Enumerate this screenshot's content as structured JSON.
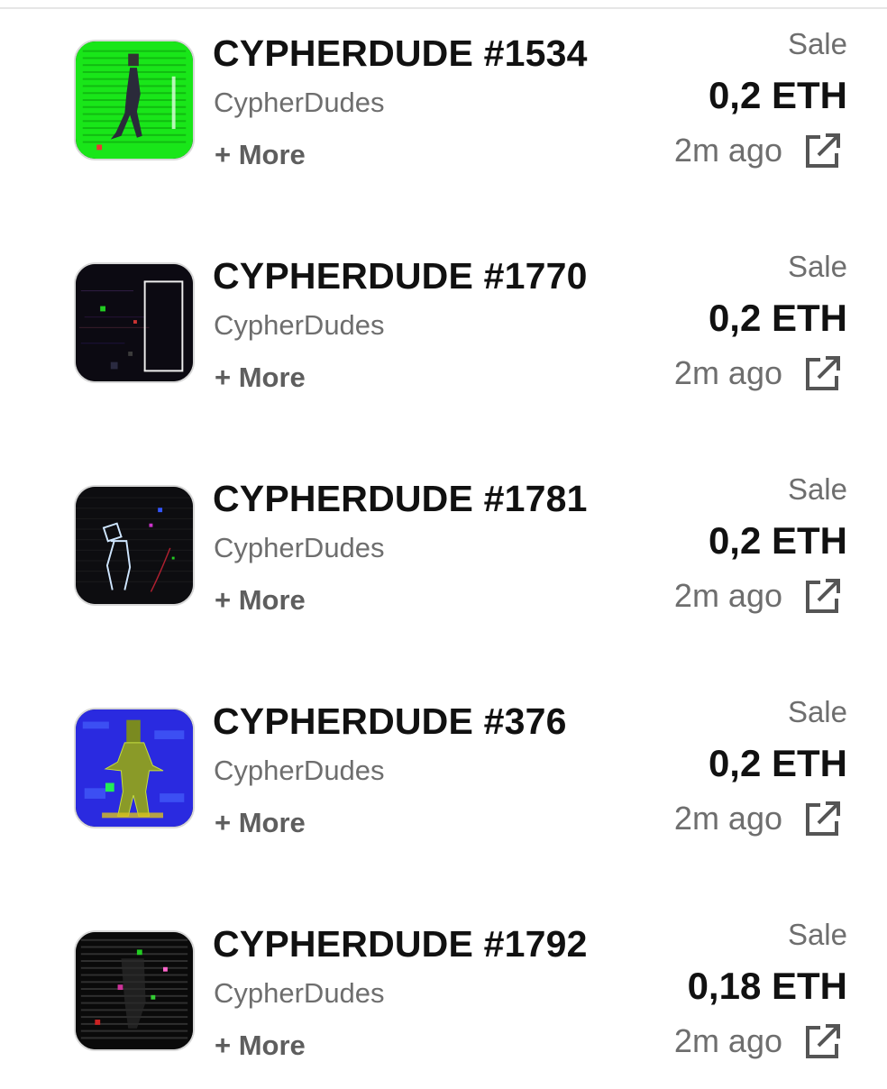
{
  "items": [
    {
      "title": "CYPHERDUDE #1534",
      "collection": "CypherDudes",
      "more": "+ More",
      "event": "Sale",
      "price": "0,2 ETH",
      "time": "2m ago",
      "thumb_bg": "#19e619",
      "link_icon": "external-link-icon"
    },
    {
      "title": "CYPHERDUDE #1770",
      "collection": "CypherDudes",
      "more": "+ More",
      "event": "Sale",
      "price": "0,2 ETH",
      "time": "2m ago",
      "thumb_bg": "#0c0a12",
      "link_icon": "external-link-icon"
    },
    {
      "title": "CYPHERDUDE #1781",
      "collection": "CypherDudes",
      "more": "+ More",
      "event": "Sale",
      "price": "0,2 ETH",
      "time": "2m ago",
      "thumb_bg": "#0d0d10",
      "link_icon": "external-link-icon"
    },
    {
      "title": "CYPHERDUDE #376",
      "collection": "CypherDudes",
      "more": "+ More",
      "event": "Sale",
      "price": "0,2 ETH",
      "time": "2m ago",
      "thumb_bg": "#2a2ae0",
      "link_icon": "external-link-icon"
    },
    {
      "title": "CYPHERDUDE #1792",
      "collection": "CypherDudes",
      "more": "+ More",
      "event": "Sale",
      "price": "0,18 ETH",
      "time": "2m ago",
      "thumb_bg": "#0a0a0a",
      "link_icon": "external-link-icon"
    }
  ]
}
